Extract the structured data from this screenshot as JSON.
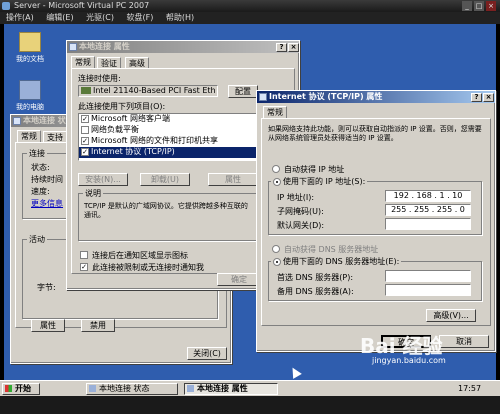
{
  "vpc": {
    "title": "Server - Microsoft Virtual PC 2007",
    "menu": [
      "操作(A)",
      "编辑(E)",
      "光驱(C)",
      "软盘(F)",
      "帮助(H)"
    ]
  },
  "desktop": {
    "icons": [
      "我的文档",
      "我的电脑"
    ]
  },
  "status_window": {
    "title": "本地连接 状态",
    "tabs": [
      "常规",
      "支持"
    ],
    "connection_group": "连接",
    "status_label": "状态:",
    "duration_label": "持续时间",
    "speed_label": "速度:",
    "more_info_link": "更多信息",
    "activity_group": "活动",
    "bytes_label": "字节:",
    "properties_button": "属性",
    "disable_button": "禁用",
    "close_button": "关闭(C)"
  },
  "props_window": {
    "title": "本地连接 属性",
    "tabs": [
      "常规",
      "验证",
      "高级"
    ],
    "connect_using_label": "连接时使用:",
    "adapter": "Intel 21140-Based PCI Fast Eth",
    "configure_button": "配置",
    "items_label": "此连接使用下列项目(O):",
    "items": [
      "Microsoft 网络客户端",
      "网络负载平衡",
      "Microsoft 网络的文件和打印机共享",
      "Internet 协议 (TCP/IP)"
    ],
    "install_button": "安装(N)...",
    "uninstall_button": "卸载(U)",
    "properties_button": "属性",
    "description_group": "说明",
    "description_text": "TCP/IP 是默认的广域网协议。它提供跨越多种互联的通讯。",
    "check_show_icon": "连接后在通知区域显示图标",
    "check_notify": "此连接被限制或无连接时通知我",
    "ok_button": "确定"
  },
  "tcpip_window": {
    "title": "Internet 协议 (TCP/IP) 属性",
    "tab": "常规",
    "intro": "如果网络支持此功能，则可以获取自动指派的 IP 设置。否则，您需要从网络系统管理员处获得适当的 IP 设置。",
    "auto_ip": "自动获得 IP 地址",
    "use_ip": "使用下面的 IP 地址(S):",
    "ip_label": "IP 地址(I):",
    "ip_value": "192 . 168 . 1 . 10",
    "mask_label": "子网掩码(U):",
    "mask_value": "255 . 255 . 255 . 0",
    "gateway_label": "默认网关(D):",
    "auto_dns": "自动获得 DNS 服务器地址",
    "use_dns": "使用下面的 DNS 服务器地址(E):",
    "dns1_label": "首选 DNS 服务器(P):",
    "dns2_label": "备用 DNS 服务器(A):",
    "advanced_button": "高级(V)...",
    "ok_button": "确定",
    "cancel_button": "取消"
  },
  "taskbar": {
    "start": "开始",
    "tasks": [
      "本地连接 状态",
      "本地连接 属性"
    ],
    "clock": "17:57"
  },
  "watermark": {
    "logo": "Bai 经验",
    "url": "jingyan.baidu.com"
  }
}
